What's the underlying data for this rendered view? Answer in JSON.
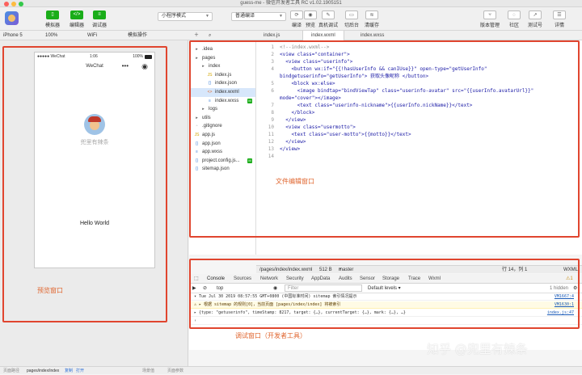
{
  "window": {
    "title": "guess-me - 微信开发者工具 RC v1.02.1905151"
  },
  "toolbar": {
    "simulator_label": "模拟器",
    "editor_label": "编辑器",
    "debugger_label": "调试器",
    "mode_select": "小程序模式",
    "compile_select": "普通编译",
    "compile_label": "编译",
    "preview_label": "预览",
    "remote_debug_label": "真机调试",
    "background_label": "切后台",
    "clear_cache_label": "清缓存",
    "version_mgmt_label": "版本管理",
    "community_label": "社区",
    "test_account_label": "测试号",
    "details_label": "详情"
  },
  "subbar": {
    "device": "iPhone 5",
    "zoom": "100%",
    "network": "WiFi",
    "sim_ops": "模拟操作",
    "tabs": [
      "index.js",
      "index.wxml",
      "index.wxss"
    ]
  },
  "phone": {
    "carrier": "●●●●● WeChat",
    "time": "1:06",
    "battery": "100%",
    "nav_title": "WeChat",
    "nickname": "兜里有辣条",
    "motto": "Hello World"
  },
  "file_tree": [
    {
      "name": ".idea",
      "icon": "folder-icon",
      "indent": 0
    },
    {
      "name": "pages",
      "icon": "folder-icon",
      "indent": 0
    },
    {
      "name": "index",
      "icon": "folder-icon",
      "indent": 1
    },
    {
      "name": "index.js",
      "icon": "js-file-icon",
      "indent": 2
    },
    {
      "name": "index.json",
      "icon": "json-file-icon",
      "indent": 2
    },
    {
      "name": "index.wxml",
      "icon": "wxml-file-icon",
      "indent": 2
    },
    {
      "name": "index.wxss",
      "icon": "wxss-file-icon",
      "indent": 2,
      "badge": "M"
    },
    {
      "name": "logs",
      "icon": "folder-icon",
      "indent": 1
    },
    {
      "name": "utils",
      "icon": "folder-icon",
      "indent": 0
    },
    {
      "name": ".gitignore",
      "icon": "file-icon",
      "indent": 0
    },
    {
      "name": "app.js",
      "icon": "js-file-icon",
      "indent": 0
    },
    {
      "name": "app.json",
      "icon": "json-file-icon",
      "indent": 0
    },
    {
      "name": "app.wxss",
      "icon": "wxss-file-icon",
      "indent": 0
    },
    {
      "name": "project.config.js...",
      "icon": "json-file-icon",
      "indent": 0,
      "badge": "M"
    },
    {
      "name": "sitemap.json",
      "icon": "json-file-icon",
      "indent": 0
    }
  ],
  "code_lines": [
    "<!--index.wxml-->",
    "<view class=\"container\">",
    "  <view class=\"userinfo\">",
    "    <button wx:if=\"{{!hasUserInfo && canIUse}}\" open-type=\"getUserInfo\"",
    "bindgetuserinfo=\"getUserInfo\"> 获取头像昵称 </button>",
    "    <block wx:else>",
    "      <image bindtap=\"bindViewTap\" class=\"userinfo-avatar\" src=\"{{userInfo.avatarUrl}}\"",
    "mode=\"cover\"></image>",
    "      <text class=\"userinfo-nickname\">{{userInfo.nickName}}</text>",
    "    </block>",
    "  </view>",
    "  <view class=\"usermotto\">",
    "    <text class=\"user-motto\">{{motto}}</text>",
    "  </view>",
    "</view>",
    ""
  ],
  "line_numbers": [
    "1",
    "2",
    "3",
    "4",
    "",
    "5",
    "6",
    "",
    "7",
    "8",
    "9",
    "10",
    "11",
    "12",
    "13",
    "14"
  ],
  "editor_status": {
    "path": "/pages/index/index.wxml",
    "size": "512 B",
    "branch": "master",
    "cursor": "行 14，列 1",
    "lang": "WXML"
  },
  "devtools": {
    "tabs": [
      "Console",
      "Sources",
      "Network",
      "Security",
      "AppData",
      "Audits",
      "Sensor",
      "Storage",
      "Trace",
      "Wxml"
    ],
    "context": "top",
    "filter_placeholder": "Filter",
    "levels": "Default levels ▾",
    "hidden": "1 hidden"
  },
  "console": [
    {
      "type": "info",
      "text": "▾ Tue Jul 30 2019 08:57:55 GMT+0800 (中国标准时间) sitemap 索引情况提示",
      "src": "VM1667:4"
    },
    {
      "type": "warn",
      "text": "⚠ ▸ 根据 sitemap 的规则[0]，当前页面 [pages/index/index] 将被索引",
      "src": "VM1630:1"
    },
    {
      "type": "log",
      "text": "▸ {type: \"getuserinfo\", timeStamp: 8217, target: {…}, currentTarget: {…}, mark: {…}, …}",
      "src": "index.js:47"
    },
    {
      "type": "prompt",
      "text": "›",
      "src": ""
    }
  ],
  "annotations": {
    "preview": "预览窗口",
    "editor": "文件编辑窗口",
    "debug": "调试窗口（开发者工具）"
  },
  "footer": {
    "path_label": "页面路径",
    "path": "pages/index/index",
    "copy": "复制",
    "open": "打开",
    "scene": "场景值",
    "params": "页面参数"
  },
  "watermark": "知乎 @兜里有辣条"
}
